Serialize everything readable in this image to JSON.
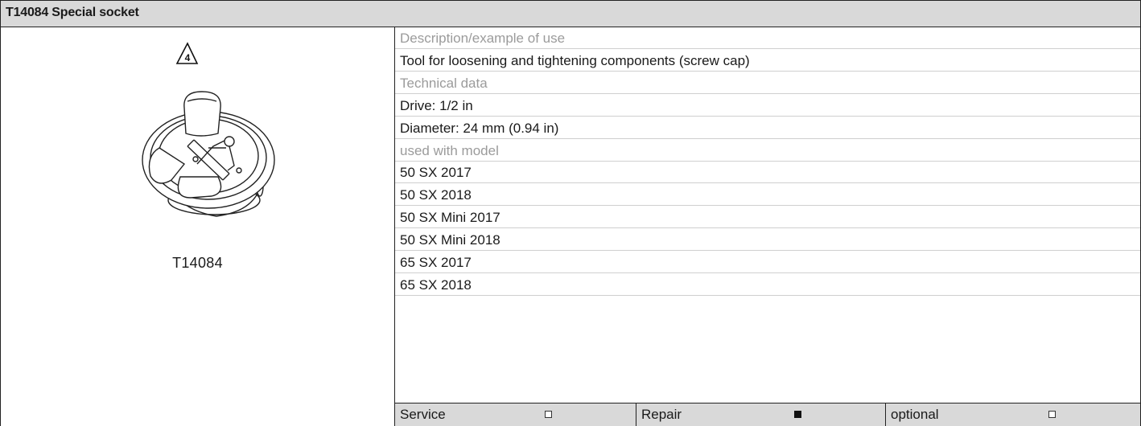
{
  "header": {
    "title": "T14084 Special socket"
  },
  "figure": {
    "warning_number": "4",
    "tool_id": "T14084"
  },
  "rows": [
    {
      "type": "label",
      "text": "Description/example of use"
    },
    {
      "type": "value",
      "text": "Tool for loosening and tightening components (screw cap)"
    },
    {
      "type": "label",
      "text": "Technical data"
    },
    {
      "type": "value",
      "text": "Drive: 1/2 in"
    },
    {
      "type": "value",
      "text": "Diameter: 24 mm (0.94 in)"
    },
    {
      "type": "label",
      "text": "used with model"
    },
    {
      "type": "value",
      "text": "50 SX 2017"
    },
    {
      "type": "value",
      "text": "50 SX 2018"
    },
    {
      "type": "value",
      "text": "50 SX Mini 2017"
    },
    {
      "type": "value",
      "text": "50 SX Mini 2018"
    },
    {
      "type": "value",
      "text": "65 SX 2017"
    },
    {
      "type": "value",
      "text": "65 SX 2018"
    }
  ],
  "footer": {
    "items": [
      {
        "label": "Service",
        "checked": false
      },
      {
        "label": "Repair",
        "checked": true
      },
      {
        "label": "optional",
        "checked": false
      }
    ]
  }
}
